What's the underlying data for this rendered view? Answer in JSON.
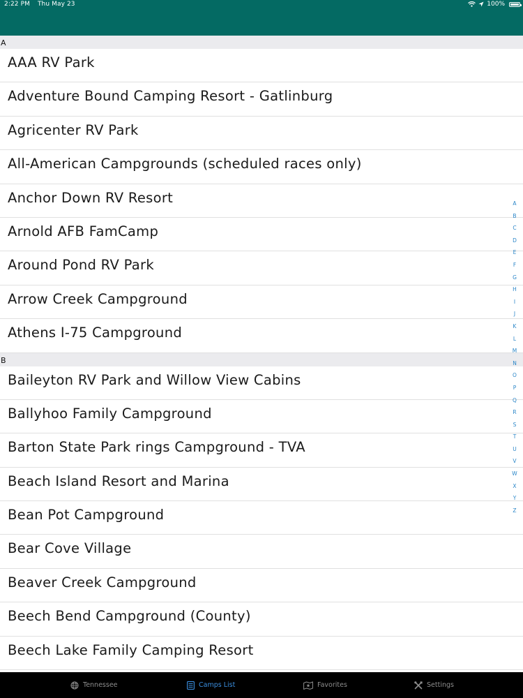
{
  "status_bar": {
    "time": "2:22 PM",
    "date": "Thu May 23",
    "battery": "100%"
  },
  "sections": [
    {
      "header": "A",
      "items": [
        "AAA RV Park",
        "Adventure Bound Camping Resort - Gatlinburg",
        "Agricenter RV Park",
        "All-American Campgrounds (scheduled races only)",
        "Anchor Down RV Resort",
        "Arnold AFB FamCamp",
        "Around Pond RV Park",
        "Arrow Creek Campground",
        "Athens I-75 Campground"
      ]
    },
    {
      "header": "B",
      "items": [
        "Baileyton RV Park and Willow View Cabins",
        "Ballyhoo Family Campground",
        "Barton State Park rings Campground - TVA",
        "Beach Island Resort and Marina",
        "Bean Pot Campground",
        "Bear Cove Village",
        "Beaver Creek Campground",
        "Beech Bend Campground (County)",
        "Beech Lake Family Camping Resort"
      ]
    }
  ],
  "index_letters": [
    "A",
    "B",
    "C",
    "D",
    "E",
    "F",
    "G",
    "H",
    "I",
    "J",
    "K",
    "L",
    "M",
    "N",
    "O",
    "P",
    "Q",
    "R",
    "S",
    "T",
    "U",
    "V",
    "W",
    "X",
    "Y",
    "Z"
  ],
  "tabs": [
    {
      "label": "Tennessee",
      "icon": "globe-icon",
      "active": false
    },
    {
      "label": "Camps List",
      "icon": "list-icon",
      "active": true
    },
    {
      "label": "Favorites",
      "icon": "map-star-icon",
      "active": false
    },
    {
      "label": "Settings",
      "icon": "tools-icon",
      "active": false
    }
  ],
  "colors": {
    "nav_bar": "#046a63",
    "section_header_bg": "#ebebee",
    "index_letter": "#2a86c8",
    "tab_active": "#3b8fe0",
    "tab_inactive": "#8e8e8e",
    "tab_bar_bg": "#000000"
  }
}
